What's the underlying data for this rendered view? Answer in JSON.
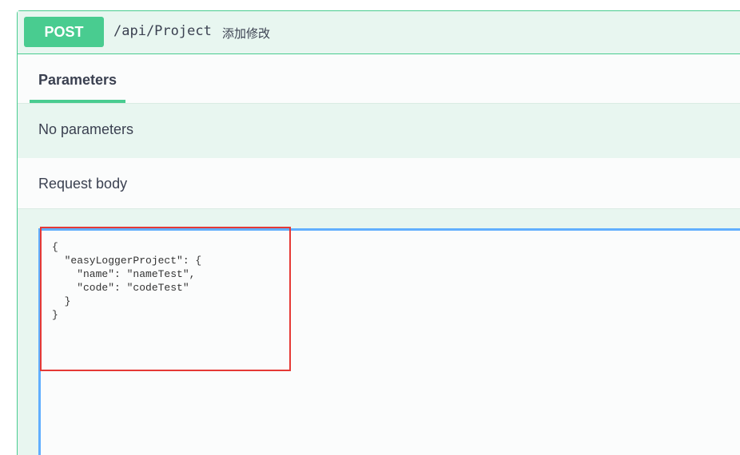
{
  "operation": {
    "method": "POST",
    "path": "/api/Project",
    "description": "添加修改"
  },
  "tabs": {
    "parameters": "Parameters"
  },
  "parameters": {
    "empty_text": "No parameters"
  },
  "request_body": {
    "title": "Request body",
    "json_text": "{\n  \"easyLoggerProject\": {\n    \"name\": \"nameTest\",\n    \"code\": \"codeTest\"\n  }\n}"
  },
  "colors": {
    "method_post": "#49cc90",
    "editor_focus": "#61affe",
    "annotation": "#e53935"
  }
}
